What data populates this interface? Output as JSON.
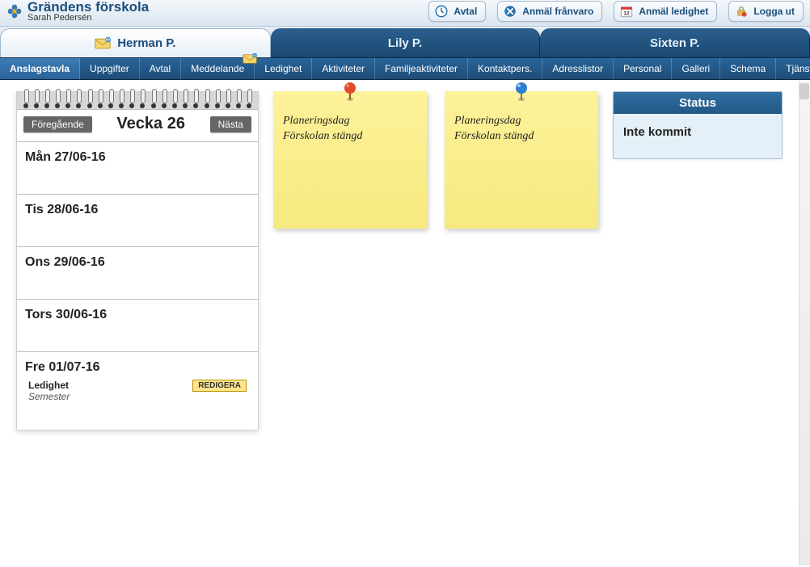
{
  "brand": {
    "title": "Grändens förskola",
    "subtitle": "Sarah Pedersén"
  },
  "header_buttons": {
    "avtal": "Avtal",
    "franvaro": "Anmäl frånvaro",
    "ledighet": "Anmäl ledighet",
    "logout": "Logga ut"
  },
  "child_tabs": [
    {
      "label": "Herman P.",
      "active": true,
      "has_mail_badge": true
    },
    {
      "label": "Lily P.",
      "active": false
    },
    {
      "label": "Sixten P.",
      "active": false
    }
  ],
  "section_tabs": [
    {
      "label": "Anslagstavla",
      "active": true
    },
    {
      "label": "Uppgifter"
    },
    {
      "label": "Avtal"
    },
    {
      "label": "Meddelande",
      "has_badge": true
    },
    {
      "label": "Ledighet"
    },
    {
      "label": "Aktiviteter"
    },
    {
      "label": "Familjeaktiviteter"
    },
    {
      "label": "Kontaktpers."
    },
    {
      "label": "Adresslistor"
    },
    {
      "label": "Personal"
    },
    {
      "label": "Galleri"
    },
    {
      "label": "Schema"
    },
    {
      "label": "Tjänster"
    }
  ],
  "week": {
    "prev": "Föregående",
    "title": "Vecka 26",
    "next": "Nästa",
    "days": [
      {
        "label": "Mån 27/06-16"
      },
      {
        "label": "Tis 28/06-16"
      },
      {
        "label": "Ons 29/06-16"
      },
      {
        "label": "Tors 30/06-16"
      },
      {
        "label": "Fre 01/07-16",
        "entry": {
          "title": "Ledighet",
          "sub": "Semester",
          "edit": "REDIGERA"
        }
      }
    ]
  },
  "stickies": [
    {
      "pin_color": "red",
      "line1": "Planeringsdag",
      "line2": "Förskolan stängd"
    },
    {
      "pin_color": "blue",
      "line1": "Planeringsdag",
      "line2": "Förskolan stängd"
    }
  ],
  "status": {
    "heading": "Status",
    "value": "Inte kommit"
  }
}
